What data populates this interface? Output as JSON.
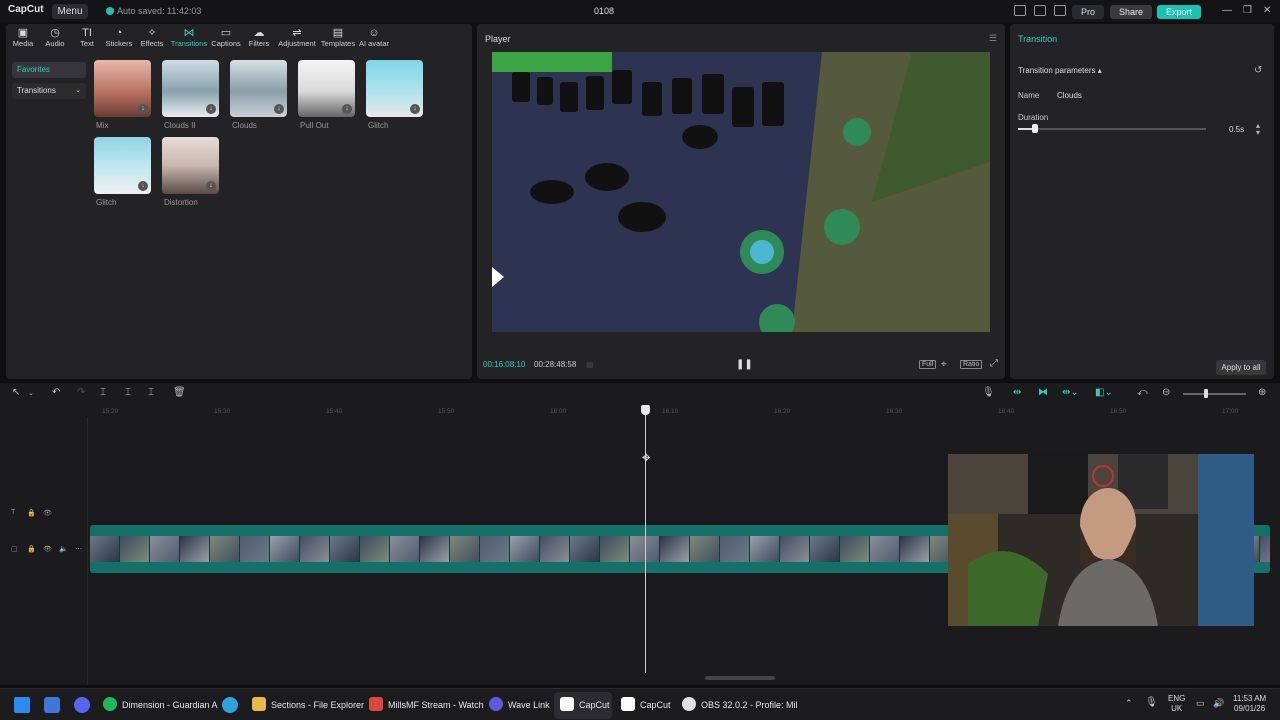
{
  "titlebar": {
    "logo": "CapCut",
    "menu_label": "Menu",
    "autosave": "Auto saved: 11:42:03",
    "project_name": "0108",
    "pro_label": "Pro",
    "share_label": "Share",
    "export_label": "Export"
  },
  "toolbar": {
    "items": [
      {
        "label": "Media",
        "icon": "▣"
      },
      {
        "label": "Audio",
        "icon": "◷"
      },
      {
        "label": "Text",
        "icon": "TI"
      },
      {
        "label": "Stickers",
        "icon": "◔"
      },
      {
        "label": "Effects",
        "icon": "✧"
      },
      {
        "label": "Transitions",
        "icon": "⋈"
      },
      {
        "label": "Captions",
        "icon": "▭"
      },
      {
        "label": "Filters",
        "icon": "☁"
      },
      {
        "label": "Adjustment",
        "icon": "⇌"
      },
      {
        "label": "Templates",
        "icon": "▤"
      },
      {
        "label": "AI avatar",
        "icon": "☺"
      }
    ]
  },
  "library": {
    "favorites_label": "Favorites",
    "transitions_label": "Transitions",
    "items": [
      {
        "label": "Mix",
        "color": "#c98a7a"
      },
      {
        "label": "Clouds II",
        "color": "#9fb6c4"
      },
      {
        "label": "Clouds",
        "color": "#a8bcc6"
      },
      {
        "label": "Pull Out",
        "color": "#e6e6e6"
      },
      {
        "label": "Glitch",
        "color": "#7fd0e0"
      },
      {
        "label": "Glitch",
        "color": "#8cc9d8"
      },
      {
        "label": "Distortion",
        "color": "#d8c8c4"
      }
    ]
  },
  "player": {
    "title": "Player",
    "current_time": "00:16:08:10",
    "total_time": "00:28:48:58",
    "play_state_icon": "❚❚",
    "full_label": "Full",
    "ratio_label": "Ratio"
  },
  "inspector": {
    "header": "Transition",
    "section": "Transition parameters",
    "name_label": "Name",
    "name_value": "Clouds",
    "duration_label": "Duration",
    "duration_value": "0.5s",
    "apply_label": "Apply to all"
  },
  "timeline": {
    "ruler": [
      "15:20",
      "15:30",
      "15:40",
      "15:50",
      "16:00",
      "16:10",
      "16:20",
      "16:30",
      "16:40",
      "16:50",
      "17:00"
    ]
  },
  "taskbar": {
    "apps": [
      {
        "label": "Dimension - Guardian A",
        "color": "#1db954"
      },
      {
        "label": "Sections - File Explorer",
        "color": "#e8b84a"
      },
      {
        "label": "MillsMF Stream - Watch",
        "color": "#e0453c"
      },
      {
        "label": "Wave Link",
        "color": "#5a5ae0"
      },
      {
        "label": "CapCut",
        "color": "#ffffff"
      },
      {
        "label": "CapCut",
        "color": "#ffffff"
      },
      {
        "label": "OBS 32.0.2 - Profile: Mil",
        "color": "#e0e0e0"
      }
    ],
    "lang1": "ENG",
    "lang2": "UK",
    "time": "11:53 AM",
    "date": "09/01/26"
  }
}
